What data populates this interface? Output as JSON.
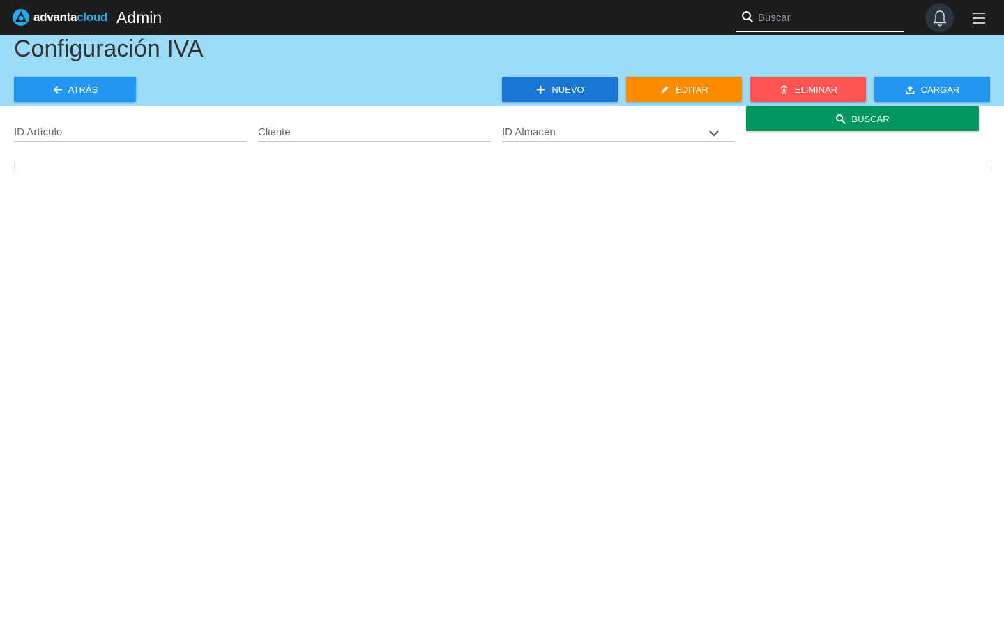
{
  "topbar": {
    "logo_text_a": "advanta",
    "logo_text_b": "cloud",
    "title": "Admin",
    "search_placeholder": "Buscar"
  },
  "page": {
    "title": "Configuración IVA"
  },
  "actions": {
    "back_label": "ATRÁS",
    "new_label": "NUEVO",
    "edit_label": "EDITAR",
    "delete_label": "ELIMINAR",
    "load_label": "CARGAR",
    "search_label": "BUSCAR"
  },
  "filters": {
    "article_id_placeholder": "ID Artículo",
    "client_placeholder": "Cliente",
    "warehouse_label": "ID Almacén"
  },
  "icons": {
    "search": "search-icon",
    "bell": "bell-icon",
    "menu": "hamburger-menu-icon",
    "back": "arrow-left-icon",
    "new": "plus-icon",
    "edit": "pencil-icon",
    "delete": "trash-icon",
    "load": "upload-icon",
    "dropdown": "chevron-down-icon"
  },
  "colors": {
    "topbar": "#1c1d1f",
    "band": "#9ddcf7",
    "back": "#2196f3",
    "new": "#1976d2",
    "edit": "#fb8c00",
    "delete": "#ff5252",
    "load": "#2196f3",
    "search": "#00965e"
  }
}
